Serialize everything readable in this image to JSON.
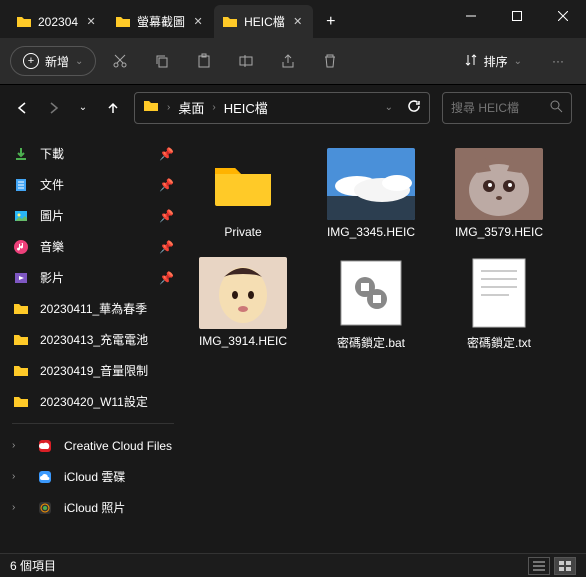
{
  "tabs": [
    {
      "label": "202304",
      "active": false
    },
    {
      "label": "螢幕截圖",
      "active": false
    },
    {
      "label": "HEIC檔",
      "active": true
    }
  ],
  "toolbar": {
    "new_label": "新增",
    "sort_label": "排序"
  },
  "breadcrumb": {
    "p0": "桌面",
    "p1": "HEIC檔"
  },
  "search": {
    "placeholder": "搜尋 HEIC檔"
  },
  "sidebar": {
    "pinned": [
      {
        "icon": "download",
        "label": "下載"
      },
      {
        "icon": "doc",
        "label": "文件"
      },
      {
        "icon": "pic",
        "label": "圖片"
      },
      {
        "icon": "music",
        "label": "音樂"
      },
      {
        "icon": "video",
        "label": "影片"
      }
    ],
    "folders": [
      {
        "label": "20230411_華為春季"
      },
      {
        "label": "20230413_充電電池"
      },
      {
        "label": "20230419_音量限制"
      },
      {
        "label": "20230420_W11設定"
      }
    ],
    "drives": [
      {
        "icon": "cc",
        "label": "Creative Cloud Files"
      },
      {
        "icon": "icloud",
        "label": "iCloud 雲碟"
      },
      {
        "icon": "iphoto",
        "label": "iCloud 照片"
      }
    ]
  },
  "items": [
    {
      "type": "folder",
      "label": "Private"
    },
    {
      "type": "photo-sky",
      "label": "IMG_3345.HEIC"
    },
    {
      "type": "photo-cat",
      "label": "IMG_3579.HEIC"
    },
    {
      "type": "photo-baby",
      "label": "IMG_3914.HEIC"
    },
    {
      "type": "bat",
      "label": "密碼鎖定.bat"
    },
    {
      "type": "txt",
      "label": "密碼鎖定.txt"
    }
  ],
  "status": {
    "count": "6 個項目"
  }
}
